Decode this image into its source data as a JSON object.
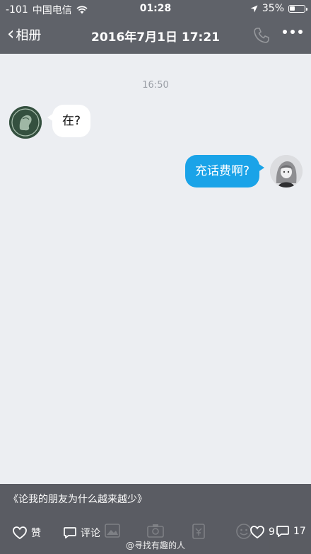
{
  "status_bar": {
    "signal": "-101",
    "carrier": "中国电信",
    "time": "01:28",
    "battery": "35%",
    "battery_level": 0.35
  },
  "header": {
    "back_label": "相册",
    "title": "2016年7月1日 17:21"
  },
  "chat": {
    "timestamp": "16:50",
    "messages": [
      {
        "side": "left",
        "text": "在?"
      },
      {
        "side": "right",
        "text": "充话费啊?"
      }
    ]
  },
  "caption": {
    "text": "《论我的朋友为什么越来越少》"
  },
  "actions": {
    "like_label": "赞",
    "comment_label": "评论",
    "likes_count": "9",
    "comments_count": "17"
  },
  "watermark": "@寻找有趣的人",
  "colors": {
    "header_bg": "#5f6269",
    "chat_bg": "#eceef2",
    "outgoing_bubble": "#1aa3e8",
    "incoming_bubble": "#ffffff"
  }
}
